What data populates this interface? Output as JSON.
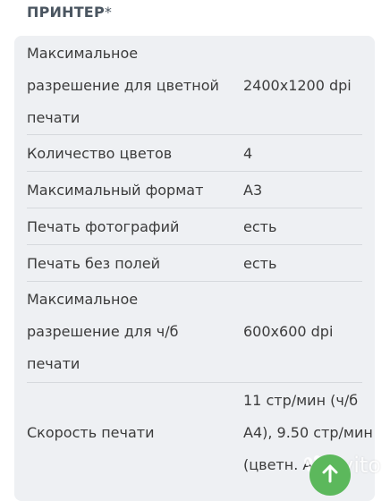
{
  "section": {
    "title": "ПРИНТЕР",
    "required_mark": "*"
  },
  "specs": [
    {
      "label": "Максимальное разрешение для цветной печати",
      "value": "2400x1200 dpi"
    },
    {
      "label": "Количество цветов",
      "value": "4"
    },
    {
      "label": "Максимальный формат",
      "value": "A3"
    },
    {
      "label": "Печать фотографий",
      "value": "есть"
    },
    {
      "label": "Печать без полей",
      "value": "есть"
    },
    {
      "label": "Максимальное разрешение для ч/б печати",
      "value": "600x600 dpi"
    },
    {
      "label": "Скорость печати",
      "value": "11 стр/мин (ч/б A4), 9.50 стр/мин (цветн. A4)"
    }
  ],
  "watermark": {
    "text": "Avito"
  },
  "icons": {
    "scroll_up": "arrow-up-icon"
  },
  "colors": {
    "card_bg": "#eef0f3",
    "divider": "#d6d9dd",
    "scroll_up_button": "#5cb85c",
    "title": "#4a5560"
  }
}
